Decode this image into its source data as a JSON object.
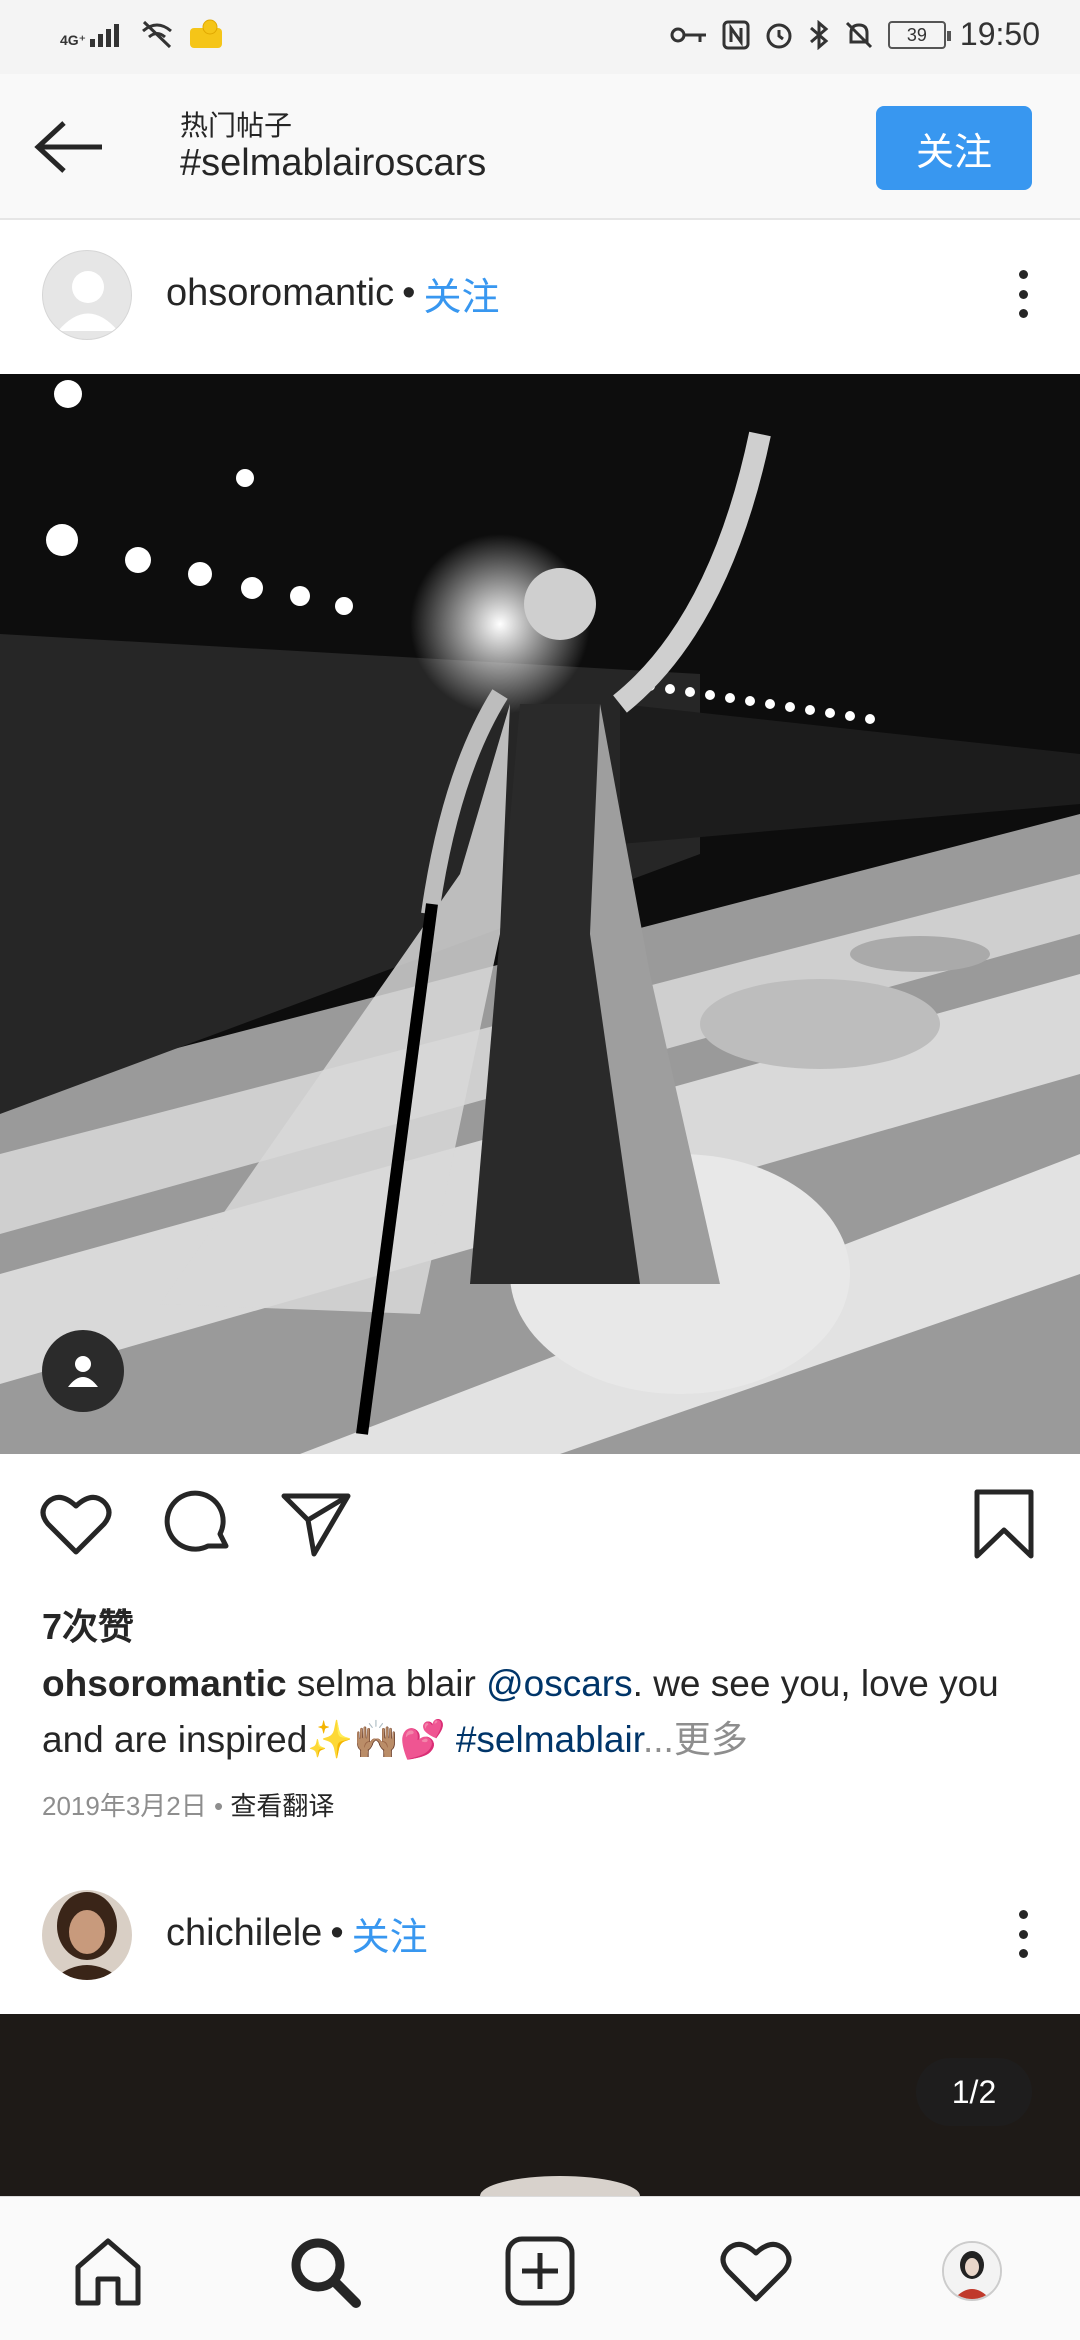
{
  "status_bar": {
    "network": "4G⁺",
    "time": "19:50",
    "battery": "39"
  },
  "header": {
    "subtitle": "热门帖子",
    "title": "#selmablairoscars",
    "follow_label": "关注"
  },
  "post1": {
    "username": "ohsoromantic",
    "separator": "•",
    "follow_label": "关注",
    "likes": "7次赞",
    "caption_user": "ohsoromantic",
    "caption_text1": " selma blair ",
    "caption_mention": "@oscars",
    "caption_text2": ". we see you, love you and are inspired✨🙌🏽💕 ",
    "caption_hashtag": "#selmablair",
    "caption_more": "...更多",
    "date": "2019年3月2日",
    "meta_separator": " • ",
    "translate_label": "查看翻译"
  },
  "post2": {
    "username": "chichilele",
    "separator": "•",
    "follow_label": "关注",
    "counter": "1/2"
  },
  "icons": {
    "back": "arrow-left-icon",
    "like": "heart-icon",
    "comment": "comment-icon",
    "share": "paper-plane-icon",
    "save": "bookmark-icon",
    "home": "home-icon",
    "search": "search-icon",
    "add": "plus-square-icon",
    "activity": "heart-icon",
    "profile": "avatar-icon"
  },
  "colors": {
    "accent": "#3897f0",
    "link": "#003569",
    "muted": "#8e8e8e"
  }
}
